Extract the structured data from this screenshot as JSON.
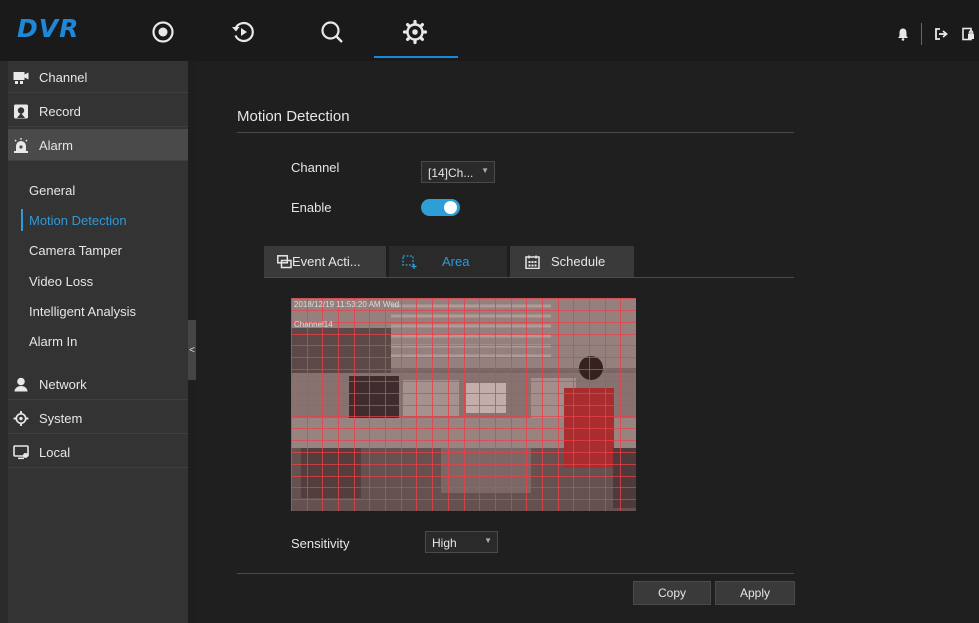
{
  "app": {
    "logo": "DVR"
  },
  "topnav": [
    {
      "name": "live-view-nav",
      "icon": "record-dot-icon"
    },
    {
      "name": "playback-nav",
      "icon": "playback-icon"
    },
    {
      "name": "search-nav",
      "icon": "search-icon"
    },
    {
      "name": "settings-nav",
      "icon": "gear-icon",
      "active": true
    }
  ],
  "topright": [
    {
      "name": "notification-button",
      "icon": "bell-icon"
    },
    {
      "name": "logout-button",
      "icon": "logout-icon"
    },
    {
      "name": "lock-button",
      "icon": "lock-icon"
    }
  ],
  "sidebar": {
    "channel": "Channel",
    "record": "Record",
    "alarm": "Alarm",
    "alarm_items": [
      "General",
      "Motion Detection",
      "Camera Tamper",
      "Video Loss",
      "Intelligent Analysis",
      "Alarm In"
    ],
    "active_item": "Motion Detection",
    "network": "Network",
    "system": "System",
    "local": "Local",
    "collapse_glyph": "<"
  },
  "main": {
    "title": "Motion Detection",
    "channel_label": "Channel",
    "channel_value": "[14]Ch...",
    "enable_label": "Enable",
    "enable_on": true,
    "tabs": [
      "Event Acti...",
      "Area",
      "Schedule"
    ],
    "active_tab": "Area",
    "osd_timestamp": "2018/12/19 11:53:20 AM Wed",
    "osd_channel": "Channel14",
    "sensitivity_label": "Sensitivity",
    "sensitivity_value": "High",
    "copy_label": "Copy",
    "apply_label": "Apply"
  },
  "colors": {
    "accent": "#1e88d8",
    "toggle_on": "#2e9ed6",
    "grid_line": "#e8404a"
  }
}
